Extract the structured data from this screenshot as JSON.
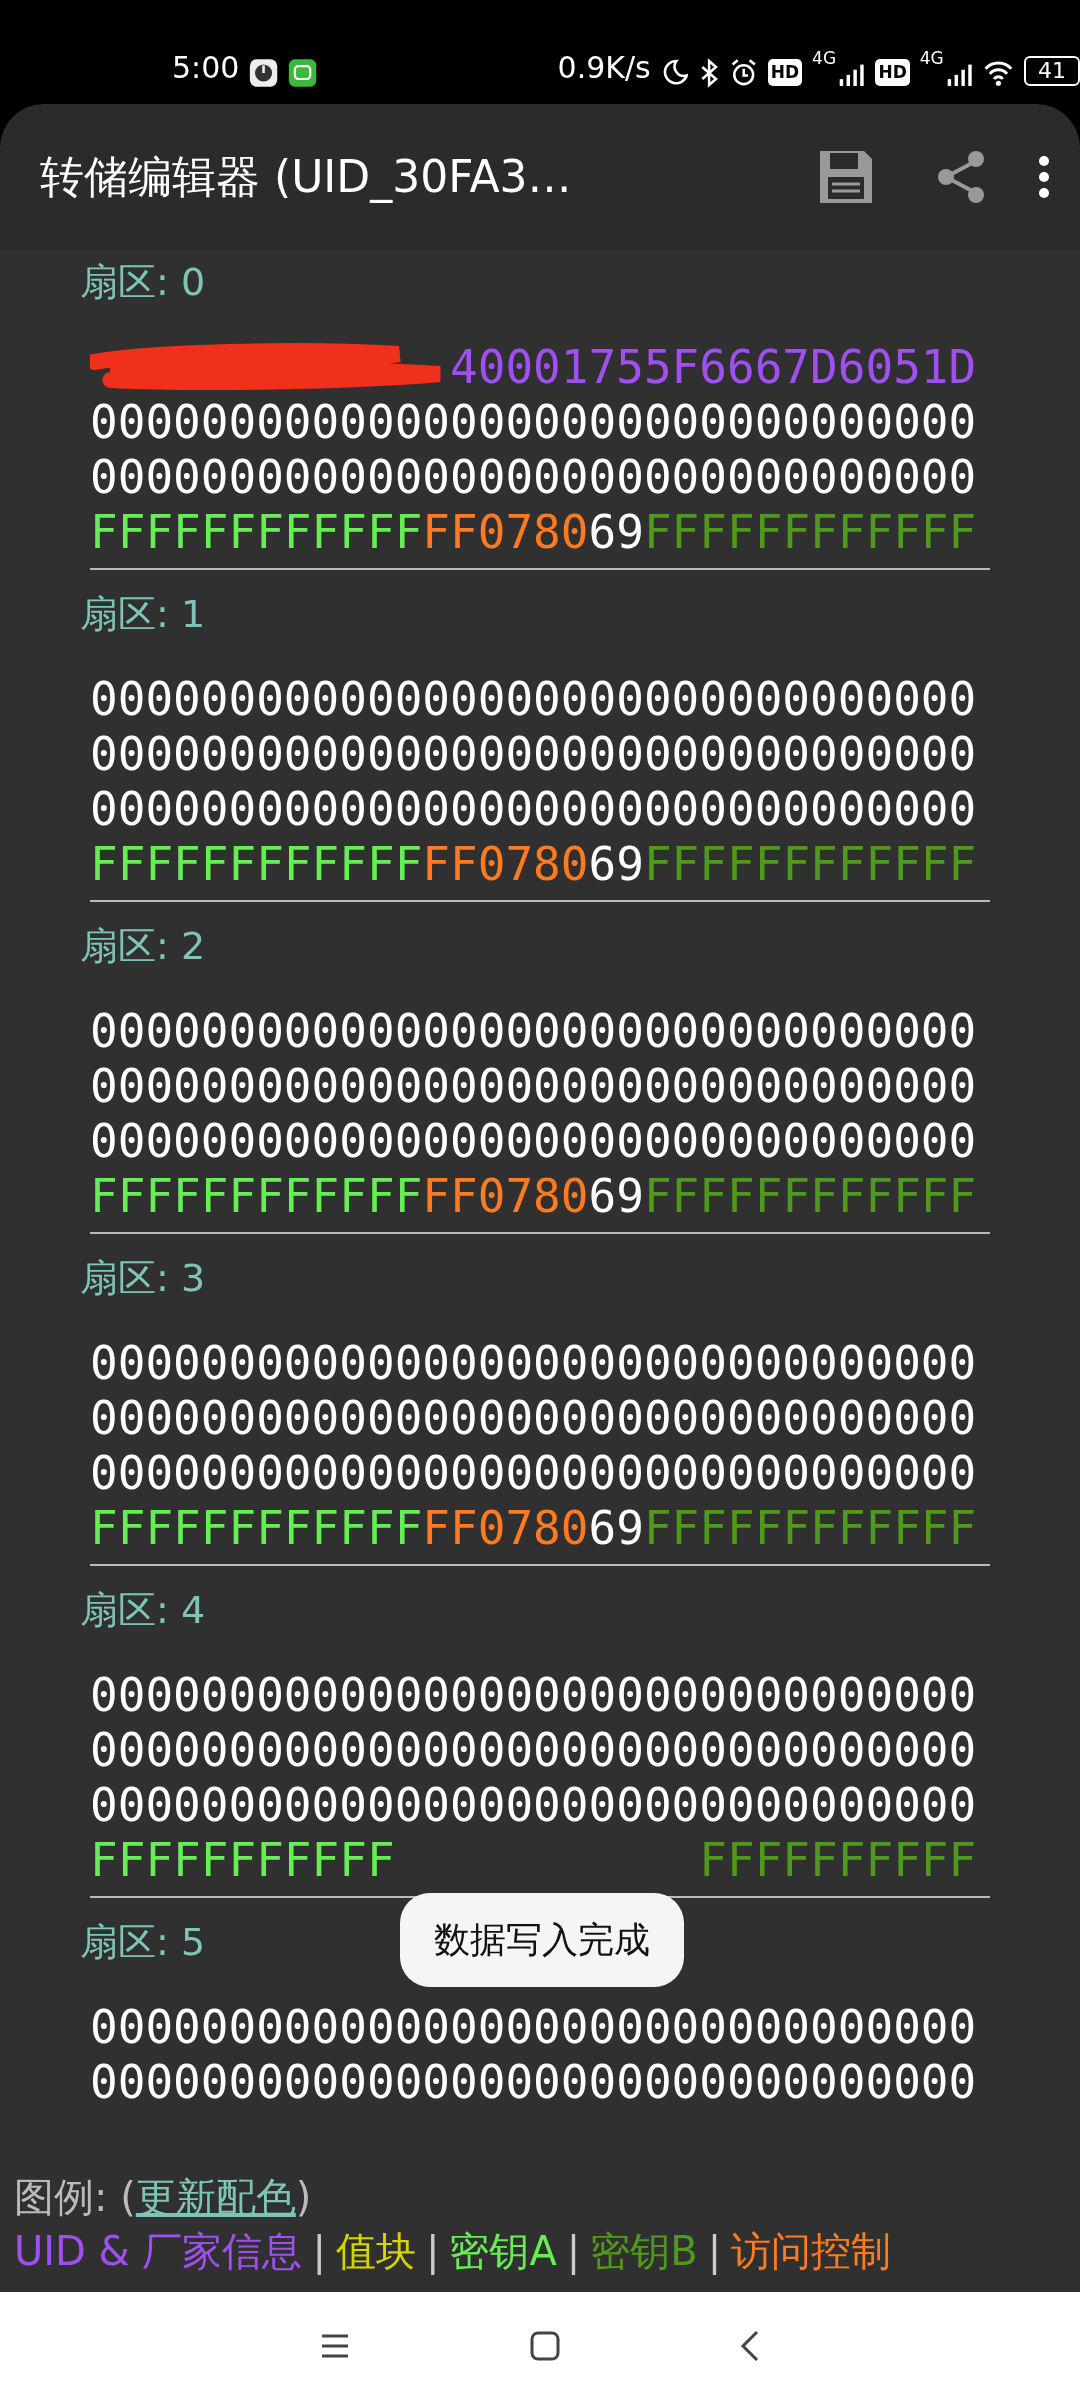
{
  "status_bar": {
    "time": "5:00",
    "speed": "0.9K/s",
    "sims": [
      {
        "hd": "HD",
        "network": "4G"
      },
      {
        "hd": "HD",
        "network": "4G"
      }
    ],
    "battery": "41"
  },
  "app_bar": {
    "title": "转储编辑器 (UID_30FA3…"
  },
  "sectors": [
    {
      "label": "扇区: 0",
      "blocks": [
        {
          "redacted": true,
          "segments": [
            {
              "kind": "uid",
              "text": "40001755F6667D6051D"
            }
          ]
        },
        {
          "redacted": false,
          "segments": [
            {
              "kind": "data",
              "text": "00000000000000000000000000000000"
            }
          ]
        },
        {
          "redacted": false,
          "segments": [
            {
              "kind": "data",
              "text": "00000000000000000000000000000000"
            }
          ]
        },
        {
          "redacted": false,
          "segments": [
            {
              "kind": "key_a",
              "text": "FFFFFFFFFFFF"
            },
            {
              "kind": "access",
              "text": "FF0780"
            },
            {
              "kind": "data",
              "text": "69"
            },
            {
              "kind": "key_b",
              "text": "FFFFFFFFFFFF"
            }
          ]
        }
      ]
    },
    {
      "label": "扇区: 1",
      "blocks": [
        {
          "redacted": false,
          "segments": [
            {
              "kind": "data",
              "text": "00000000000000000000000000000000"
            }
          ]
        },
        {
          "redacted": false,
          "segments": [
            {
              "kind": "data",
              "text": "00000000000000000000000000000000"
            }
          ]
        },
        {
          "redacted": false,
          "segments": [
            {
              "kind": "data",
              "text": "00000000000000000000000000000000"
            }
          ]
        },
        {
          "redacted": false,
          "segments": [
            {
              "kind": "key_a",
              "text": "FFFFFFFFFFFF"
            },
            {
              "kind": "access",
              "text": "FF0780"
            },
            {
              "kind": "data",
              "text": "69"
            },
            {
              "kind": "key_b",
              "text": "FFFFFFFFFFFF"
            }
          ]
        }
      ]
    },
    {
      "label": "扇区: 2",
      "blocks": [
        {
          "redacted": false,
          "segments": [
            {
              "kind": "data",
              "text": "00000000000000000000000000000000"
            }
          ]
        },
        {
          "redacted": false,
          "segments": [
            {
              "kind": "data",
              "text": "00000000000000000000000000000000"
            }
          ]
        },
        {
          "redacted": false,
          "segments": [
            {
              "kind": "data",
              "text": "00000000000000000000000000000000"
            }
          ]
        },
        {
          "redacted": false,
          "segments": [
            {
              "kind": "key_a",
              "text": "FFFFFFFFFFFF"
            },
            {
              "kind": "access",
              "text": "FF0780"
            },
            {
              "kind": "data",
              "text": "69"
            },
            {
              "kind": "key_b",
              "text": "FFFFFFFFFFFF"
            }
          ]
        }
      ]
    },
    {
      "label": "扇区: 3",
      "blocks": [
        {
          "redacted": false,
          "segments": [
            {
              "kind": "data",
              "text": "00000000000000000000000000000000"
            }
          ]
        },
        {
          "redacted": false,
          "segments": [
            {
              "kind": "data",
              "text": "00000000000000000000000000000000"
            }
          ]
        },
        {
          "redacted": false,
          "segments": [
            {
              "kind": "data",
              "text": "00000000000000000000000000000000"
            }
          ]
        },
        {
          "redacted": false,
          "segments": [
            {
              "kind": "key_a",
              "text": "FFFFFFFFFFFF"
            },
            {
              "kind": "access",
              "text": "FF0780"
            },
            {
              "kind": "data",
              "text": "69"
            },
            {
              "kind": "key_b",
              "text": "FFFFFFFFFFFF"
            }
          ]
        }
      ]
    },
    {
      "label": "扇区: 4",
      "blocks": [
        {
          "redacted": false,
          "segments": [
            {
              "kind": "data",
              "text": "00000000000000000000000000000000"
            }
          ]
        },
        {
          "redacted": false,
          "segments": [
            {
              "kind": "data",
              "text": "00000000000000000000000000000000"
            }
          ]
        },
        {
          "redacted": false,
          "segments": [
            {
              "kind": "data",
              "text": "00000000000000000000000000000000"
            }
          ]
        },
        {
          "redacted": false,
          "segments": [
            {
              "kind": "key_a",
              "text": "FFFFFFFFFFF"
            },
            {
              "kind": "key_b",
              "text": "FFFFFFFFFF"
            }
          ]
        }
      ]
    },
    {
      "label": "扇区: 5",
      "blocks": [
        {
          "redacted": false,
          "segments": [
            {
              "kind": "data",
              "text": "00000000000000000000000000000000"
            }
          ]
        },
        {
          "redacted": false,
          "segments": [
            {
              "kind": "data",
              "text": "00000000000000000000000000000000"
            }
          ]
        }
      ]
    }
  ],
  "toast": {
    "text": "数据写入完成"
  },
  "legend": {
    "label": "图例: (",
    "link": "更新配色",
    "close": ")",
    "items": [
      {
        "kind": "uid",
        "text": "UID & 厂家信息"
      },
      {
        "kind": "sep",
        "text": "|"
      },
      {
        "kind": "value",
        "text": "值块"
      },
      {
        "kind": "sep",
        "text": "|"
      },
      {
        "kind": "key_a",
        "text": "密钥A"
      },
      {
        "kind": "sep",
        "text": "|"
      },
      {
        "kind": "key_b",
        "text": "密钥B"
      },
      {
        "kind": "sep",
        "text": "|"
      },
      {
        "kind": "access",
        "text": "访问控制"
      }
    ]
  }
}
